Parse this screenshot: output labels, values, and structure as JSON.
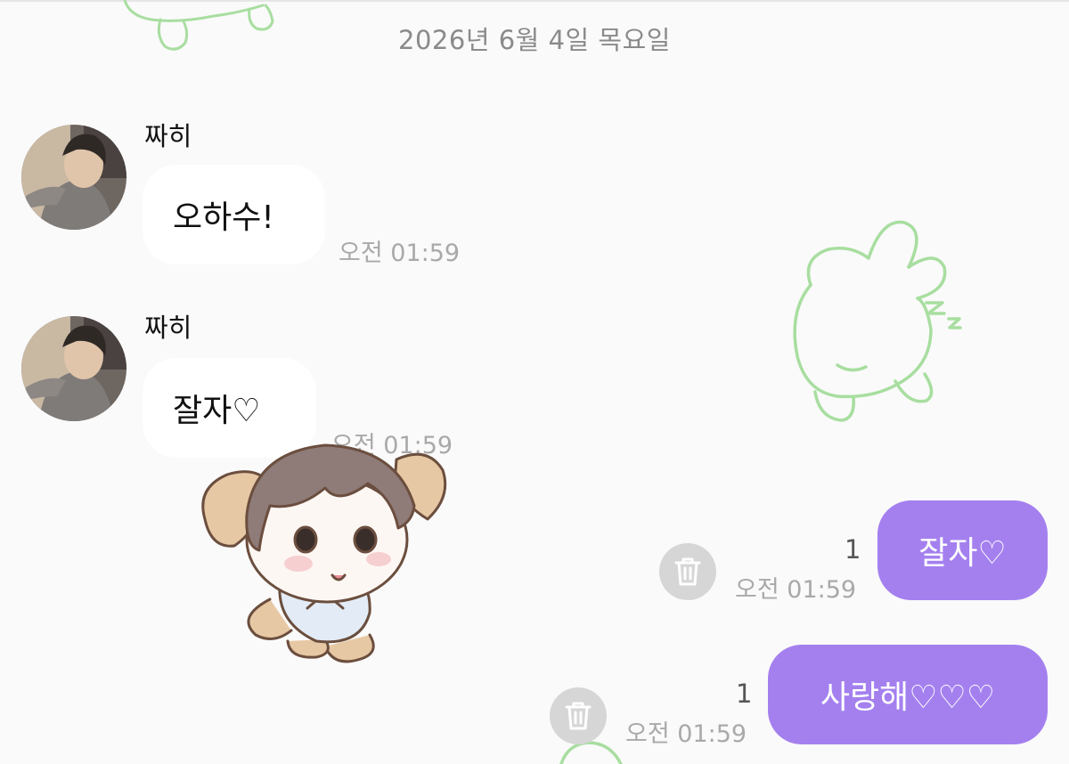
{
  "chat": {
    "date_header": "2026년 6월 4일 목요일",
    "messages": [
      {
        "direction": "incoming",
        "sender": "짜히",
        "text": "오하수!",
        "time": "오전 01:59"
      },
      {
        "direction": "incoming",
        "sender": "짜히",
        "text": "잘자♡",
        "time": "오전 01:59"
      },
      {
        "direction": "outgoing",
        "text": "잘자♡",
        "time": "오전 01:59",
        "unread_count": "1"
      },
      {
        "direction": "outgoing",
        "text": "사랑해♡♡♡",
        "time": "오전 01:59",
        "unread_count": "1"
      }
    ]
  },
  "icons": {
    "delete": "trash-icon",
    "sticker": "puppy-sticker",
    "wallpaper": "sleeping-bunny-doodle"
  },
  "colors": {
    "outgoing_bubble": "#a480ef",
    "incoming_bubble": "#ffffff",
    "background": "#fafafa",
    "time_text": "#a9a9a9",
    "doodle_line": "#a8dea0"
  }
}
